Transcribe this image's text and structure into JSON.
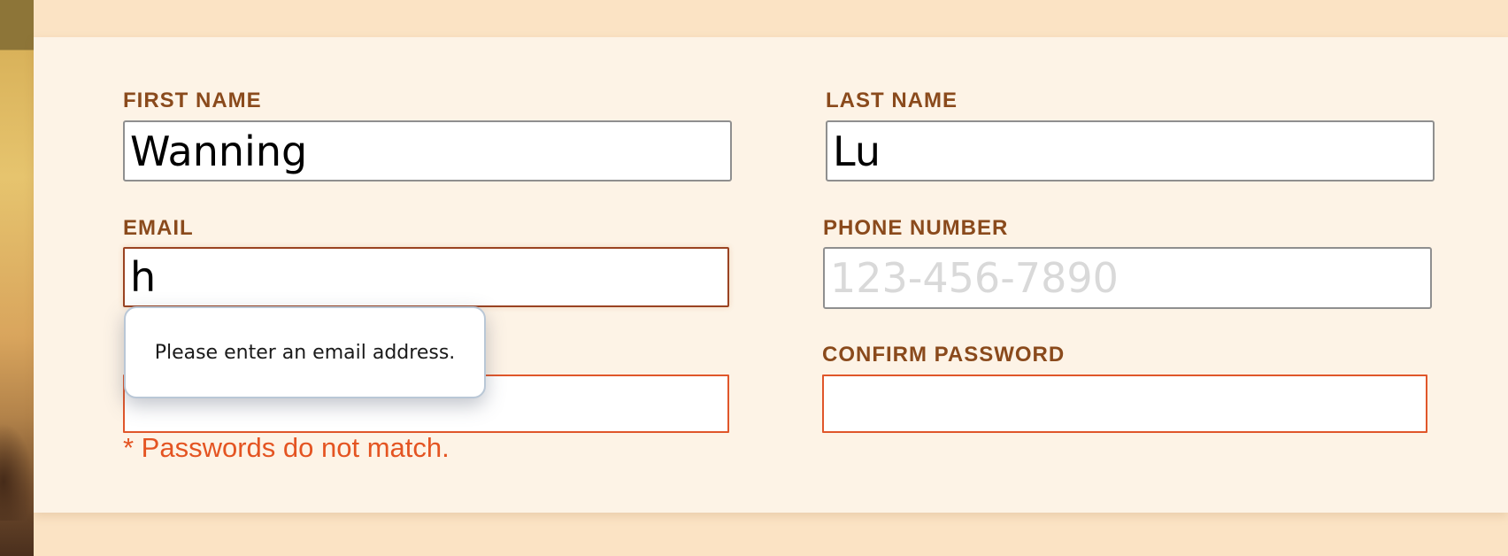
{
  "form": {
    "first_name": {
      "label": "FIRST NAME",
      "value": "Wanning"
    },
    "last_name": {
      "label": "LAST NAME",
      "value": "Lu"
    },
    "email": {
      "label": "EMAIL",
      "value": "h",
      "validation_tooltip": "Please enter an email address."
    },
    "phone": {
      "label": "PHONE NUMBER",
      "value": "",
      "placeholder": "123-456-7890"
    },
    "password": {
      "value": "",
      "error": "* Passwords do not match."
    },
    "confirm_password": {
      "label": "CONFIRM PASSWORD",
      "value": ""
    }
  },
  "colors": {
    "page_background": "#fbe3c4",
    "card_background": "#fdf3e6",
    "label": "#8a4a1c",
    "error": "#e45422",
    "email_border": "#9a4322"
  }
}
